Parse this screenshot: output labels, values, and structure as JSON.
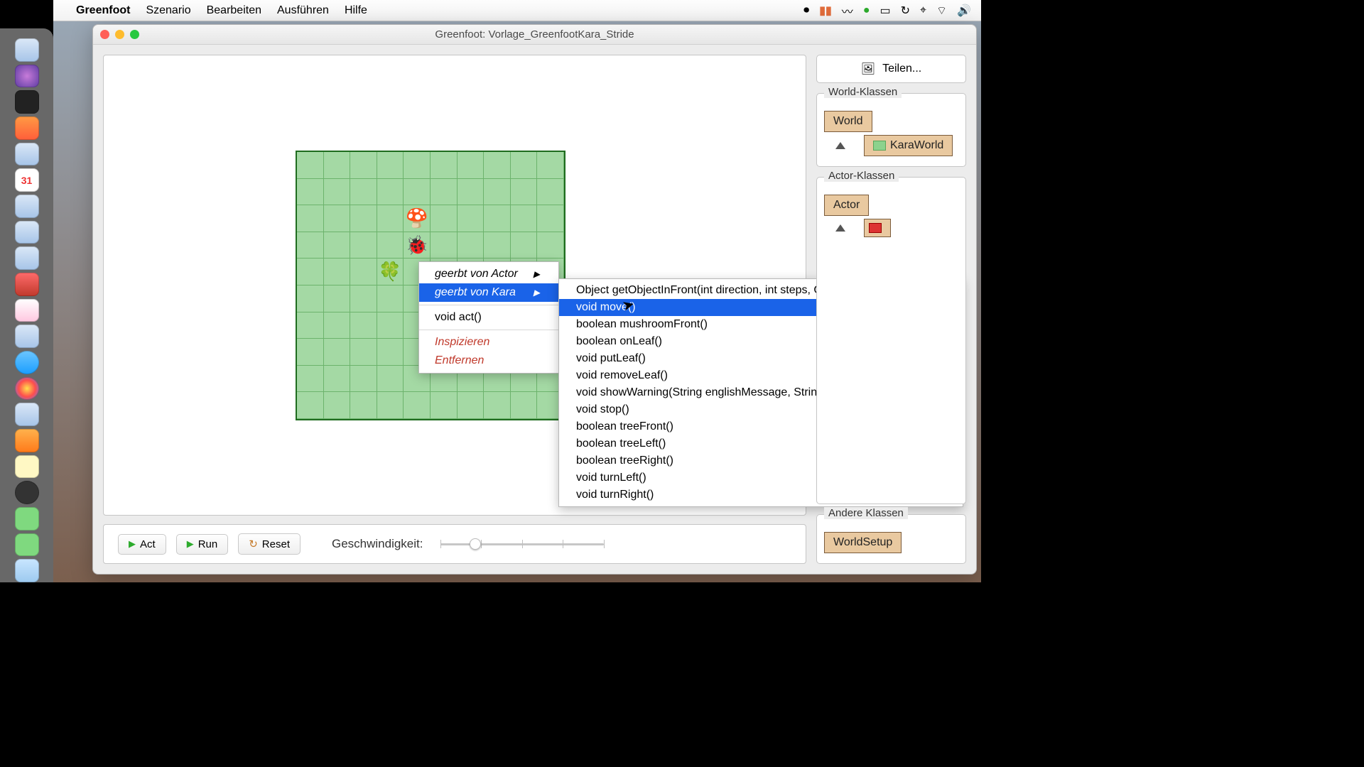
{
  "menubar": {
    "app": "Greenfoot",
    "items": [
      "Szenario",
      "Bearbeiten",
      "Ausführen",
      "Hilfe"
    ]
  },
  "window": {
    "title": "Greenfoot: Vorlage_GreenfootKara_Stride"
  },
  "controls": {
    "act": "Act",
    "run": "Run",
    "reset": "Reset",
    "speed_label": "Geschwindigkeit:"
  },
  "share": {
    "label": "Teilen..."
  },
  "panels": {
    "world_title": "World-Klassen",
    "actor_title": "Actor-Klassen",
    "other_title": "Andere Klassen",
    "world_root": "World",
    "world_sub": "KaraWorld",
    "actor_root": "Actor",
    "other_root": "WorldSetup"
  },
  "ctx": {
    "inherited_actor": "geerbt von Actor",
    "inherited_kara": "geerbt von Kara",
    "act": "void act()",
    "inspect": "Inspizieren",
    "remove": "Entfernen"
  },
  "submenu": [
    "Object getObjectInFront(int direction, int steps, Class<?> clazz)",
    "void move()",
    "boolean mushroomFront()",
    "boolean onLeaf()",
    "void putLeaf()",
    "void removeLeaf()",
    "void showWarning(String englishMessage, String germanMessage)",
    "void stop()",
    "boolean treeFront()",
    "boolean treeLeft()",
    "boolean treeRight()",
    "void turnLeft()",
    "void turnRight()"
  ],
  "submenu_selected_index": 1
}
